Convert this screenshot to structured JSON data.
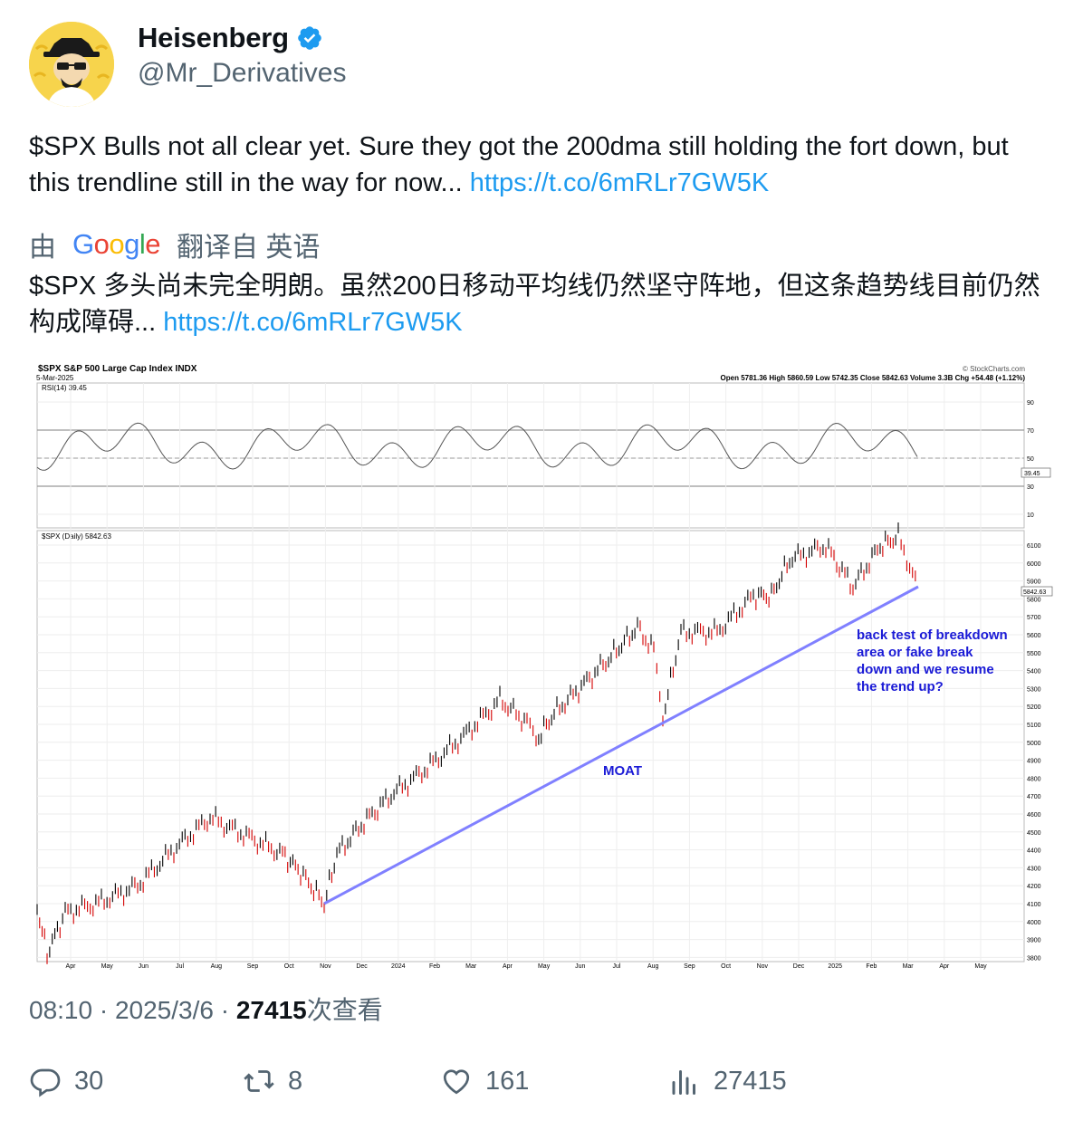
{
  "author": {
    "display_name": "Heisenberg",
    "handle": "@Mr_Derivatives",
    "verified": true,
    "avatar_icon": "heisenberg-avatar-icon"
  },
  "tweet": {
    "text": "$SPX Bulls not all clear yet. Sure they got the 200dma still holding the fort down, but this trendline still in the way for now... ",
    "link": "https://t.co/6mRLr7GW5K"
  },
  "translation": {
    "prefix": "由",
    "provider": "Google",
    "suffix": "翻译自 英语",
    "text": "$SPX 多头尚未完全明朗。虽然200日移动平均线仍然坚守阵地，但这条趋势线目前仍然构成障碍... ",
    "link": "https://t.co/6mRLr7GW5K"
  },
  "chart_image": {
    "title": "$SPX S&P 500 Large Cap Index INDX",
    "date": "5-Mar-2025",
    "source": "© StockCharts.com",
    "ohlc": "Open 5781.36  High 5860.59  Low 5742.35  Close 5842.63  Volume 3.3B  Chg +54.48 (+1.12%)",
    "rsi_label": "RSI(14) 39.45",
    "rsi_value_tag": "39.45",
    "price_label": "$SPX (Daily) 5842.63",
    "price_value_tag": "5842.63",
    "annotation_moat": "MOAT",
    "annotation_note": [
      "back test of breakdown",
      "area or fake break",
      "down and we resume",
      "the trend up?"
    ],
    "rsi_ticks": [
      "90",
      "70",
      "50",
      "30",
      "10"
    ],
    "price_ticks": [
      "6100",
      "6000",
      "5900",
      "5800",
      "5700",
      "5600",
      "5500",
      "5400",
      "5300",
      "5200",
      "5100",
      "5000",
      "4900",
      "4800",
      "4700",
      "4600",
      "4500",
      "4400",
      "4300",
      "4200",
      "4100",
      "4000",
      "3900",
      "3800"
    ],
    "month_ticks": [
      "Apr",
      "May",
      "Jun",
      "Jul",
      "Aug",
      "Sep",
      "Oct",
      "Nov",
      "Dec",
      "2024",
      "Feb",
      "Mar",
      "Apr",
      "May",
      "Jun",
      "Jul",
      "Aug",
      "Sep",
      "Oct",
      "Nov",
      "Dec",
      "2025",
      "Feb",
      "Mar",
      "Apr",
      "May"
    ],
    "colors": {
      "trendline": "#8080ff",
      "annotation": "#1a1ad6",
      "up": "#000000",
      "down": "#d40000",
      "rsi_fill": "#4a8a4a"
    }
  },
  "meta": {
    "time": "08:10",
    "date": "2025/3/6",
    "views": "27415",
    "views_label": "次查看",
    "separator": " · "
  },
  "actions": {
    "replies": "30",
    "retweets": "8",
    "likes": "161",
    "views": "27415"
  }
}
